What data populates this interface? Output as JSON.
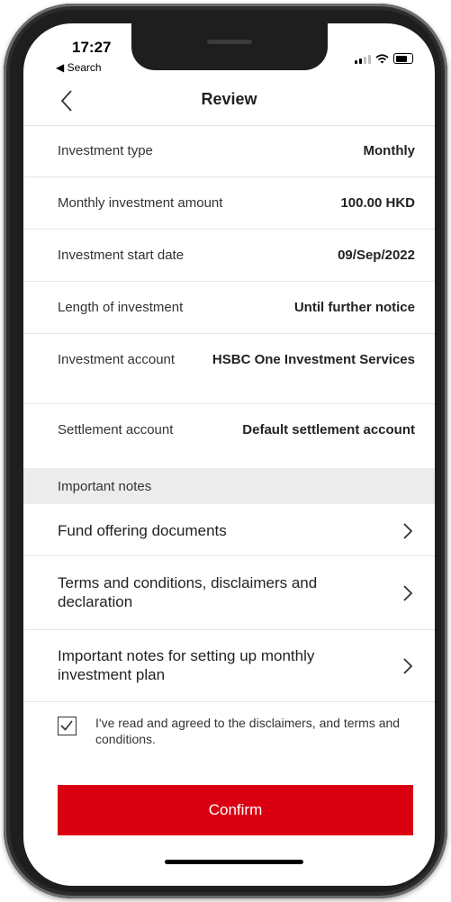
{
  "status_bar": {
    "time": "17:27",
    "back_app": "◀ Search"
  },
  "nav": {
    "title": "Review"
  },
  "details": [
    {
      "label": "Investment type",
      "value": "Monthly"
    },
    {
      "label": "Monthly investment amount",
      "value": "100.00 HKD"
    },
    {
      "label": "Investment start date",
      "value": "09/Sep/2022"
    },
    {
      "label": "Length of investment",
      "value": "Until further notice"
    },
    {
      "label": "Investment account",
      "value": "HSBC One Investment Services"
    },
    {
      "label": "Settlement account",
      "value": "Default settlement account"
    }
  ],
  "important_notes": {
    "header": "Important notes",
    "links": [
      {
        "label": "Fund offering documents"
      },
      {
        "label": "Terms and conditions, disclaimers and declaration"
      },
      {
        "label": "Important notes for setting up monthly investment plan"
      }
    ]
  },
  "agreement": {
    "checked": true,
    "text": "I've read and agreed to the disclaimers, and terms and conditions."
  },
  "confirm_button": {
    "label": "Confirm"
  },
  "colors": {
    "brand_red": "#db0011",
    "section_bg": "#ececec"
  }
}
